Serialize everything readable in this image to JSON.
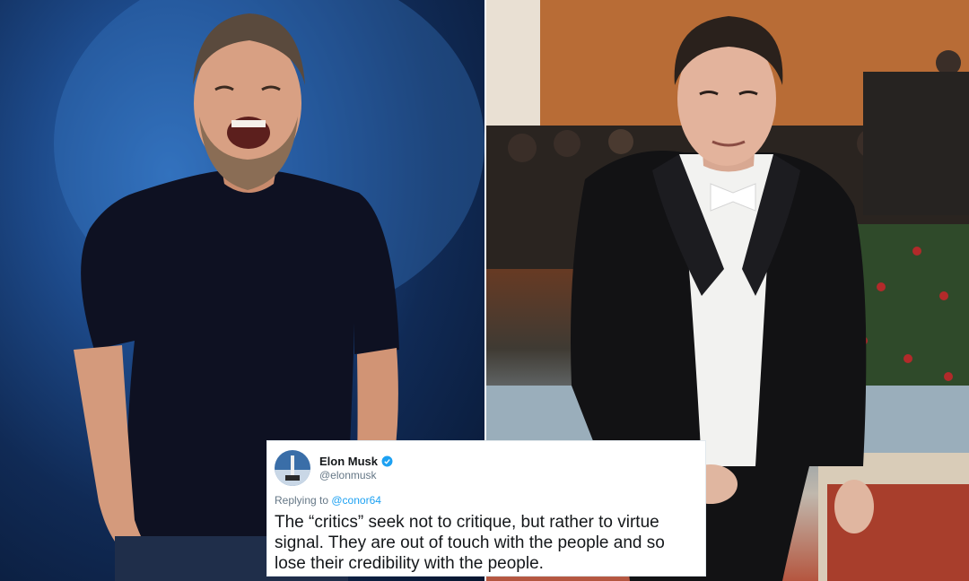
{
  "tweet": {
    "name": "Elon Musk",
    "handle": "@elonmusk",
    "replying_prefix": "Replying to ",
    "replying_handle": "@conor64",
    "text": "The “critics” seek not to critique, but rather to virtue signal. They are out of touch with the people and so lose their credibility with the people.",
    "verified_icon": "verified-badge-icon",
    "accent_color": "#1da1f2"
  }
}
